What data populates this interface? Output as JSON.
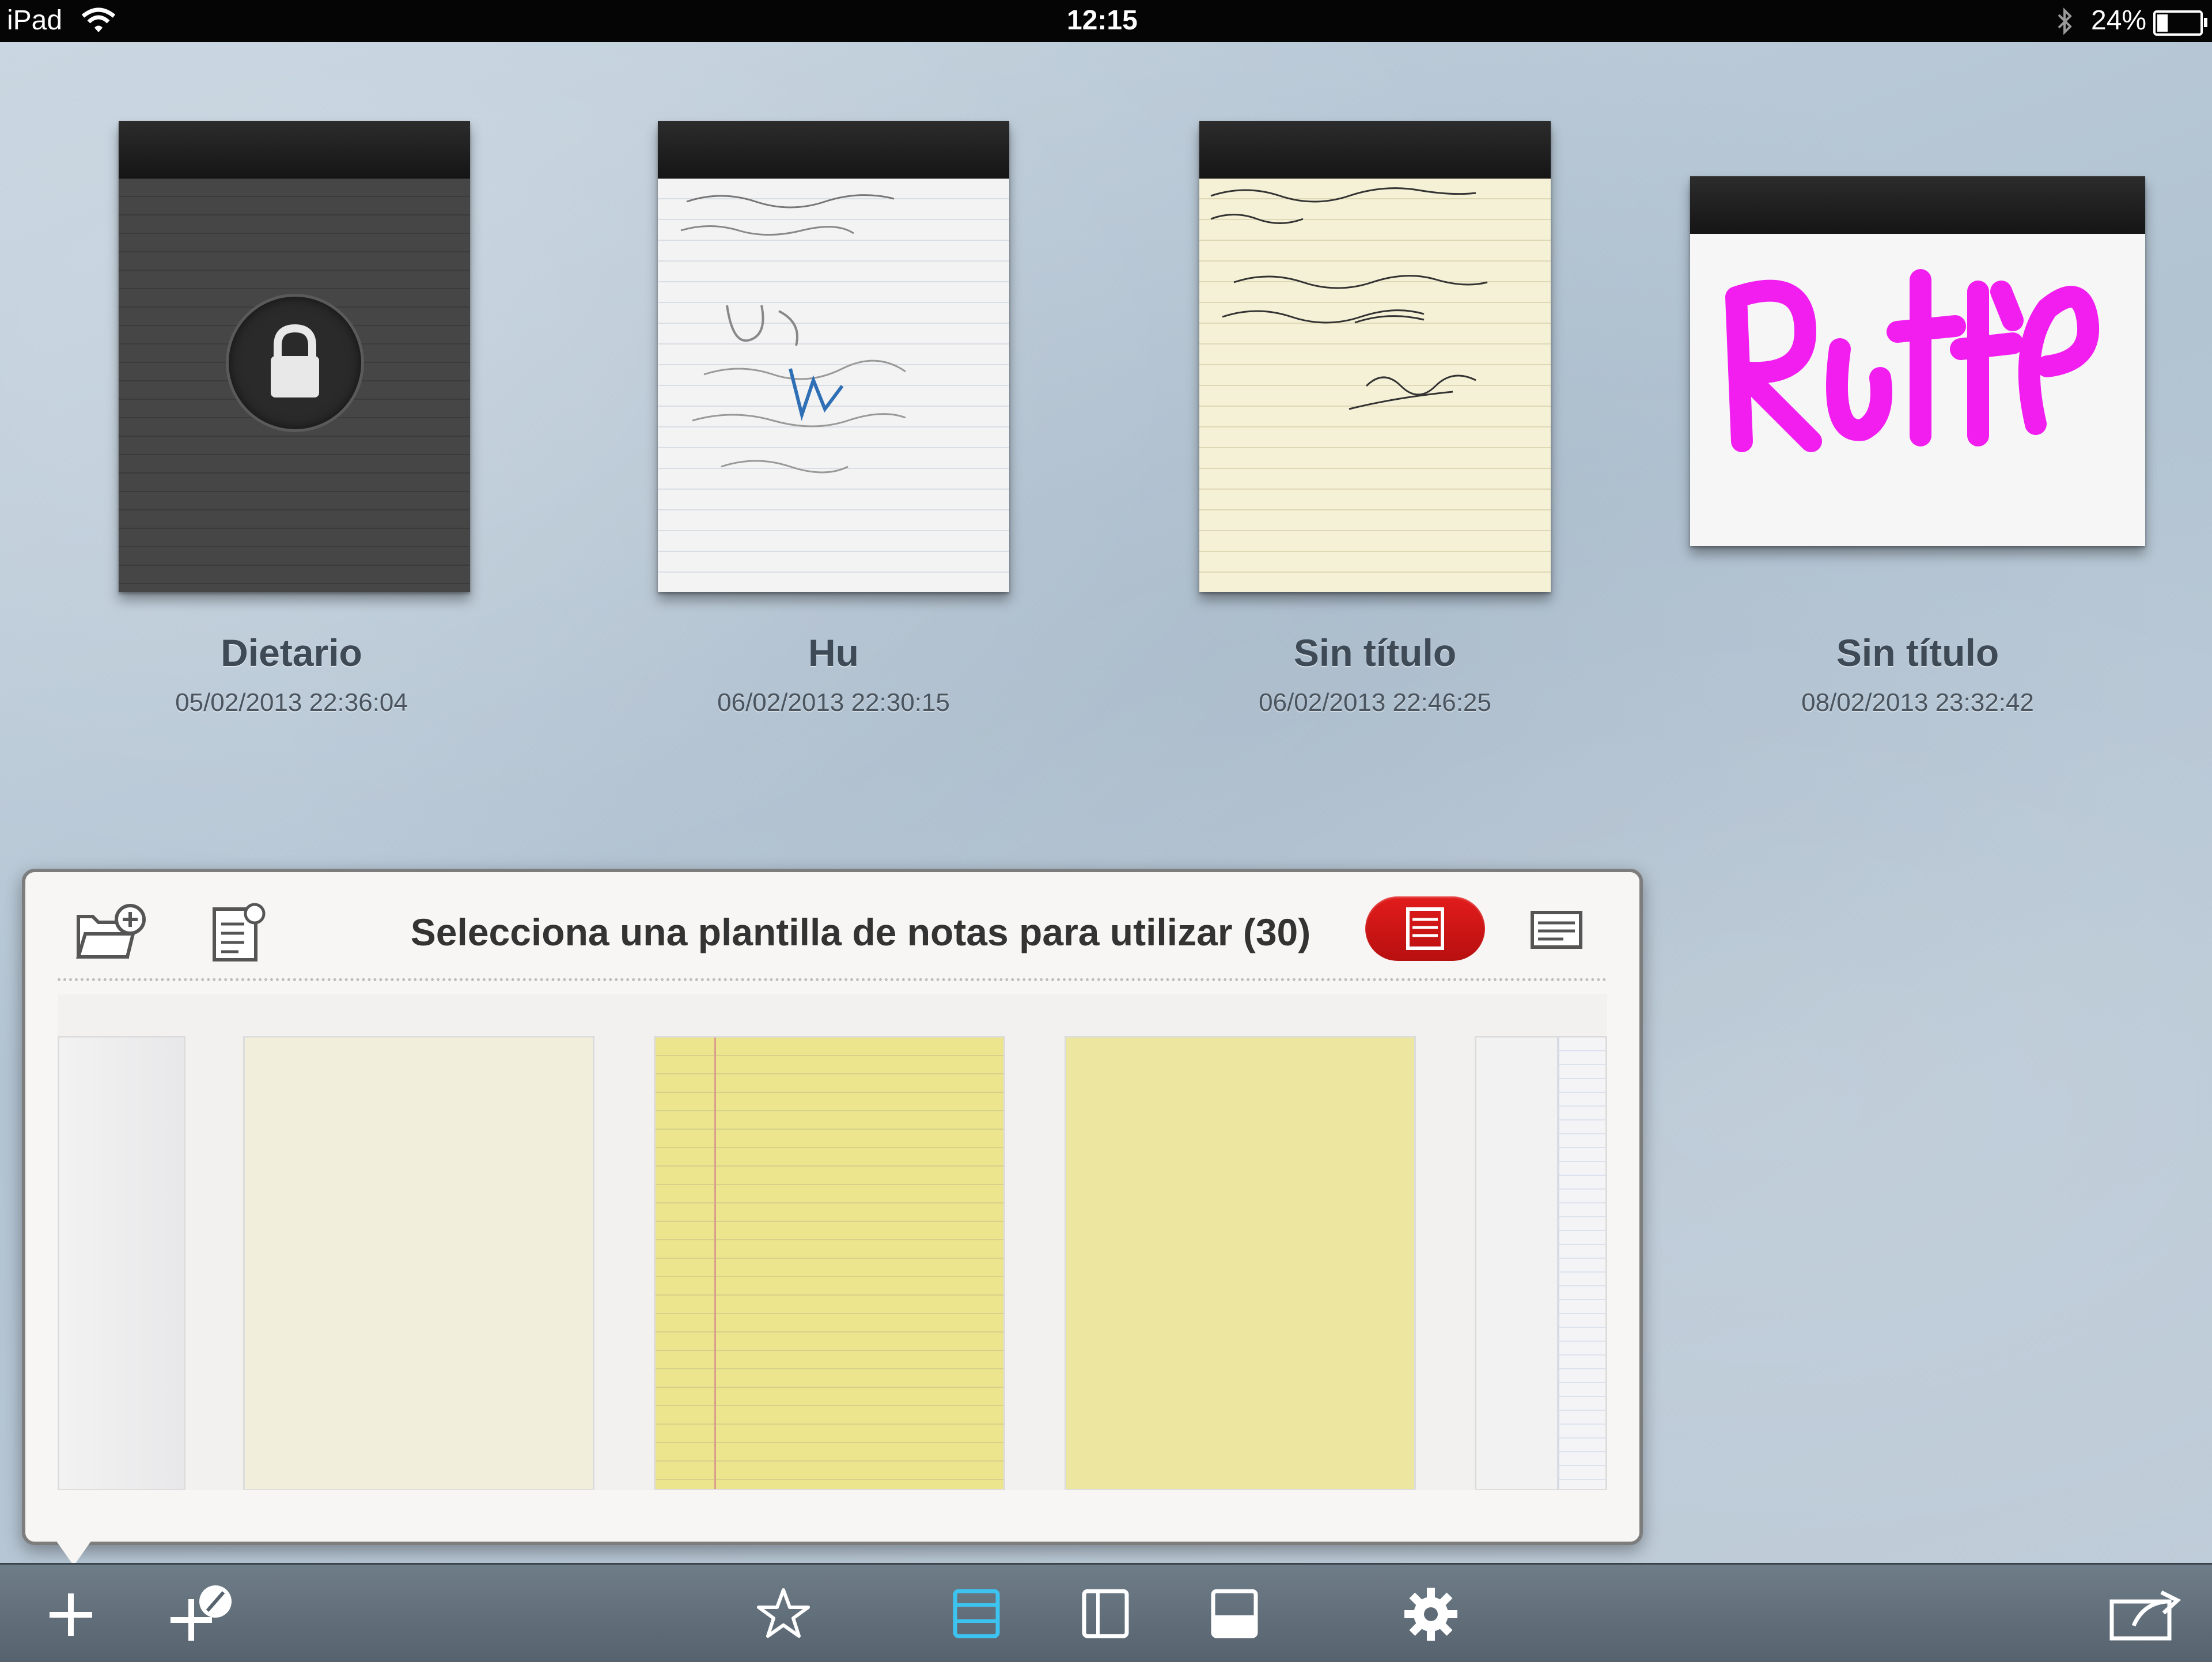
{
  "status_bar": {
    "device": "iPad",
    "time": "12:15",
    "battery": "24%",
    "icons": [
      "wifi-icon",
      "bluetooth-icon",
      "battery-icon"
    ]
  },
  "notebooks": [
    {
      "title": "Dietario",
      "date": "05/02/2013 22:36:04",
      "locked": true
    },
    {
      "title": "Hu",
      "date": "06/02/2013 22:30:15",
      "locked": false
    },
    {
      "title": "Sin título",
      "date": "06/02/2013 22:46:25",
      "locked": false
    },
    {
      "title": "Sin título",
      "date": "08/02/2013 23:32:42",
      "locked": false
    }
  ],
  "popover": {
    "title": "Selecciona una plantilla de notas para utilizar (30)",
    "icons": [
      "add-folder-icon",
      "note-settings-icon",
      "portrait-template-icon",
      "landscape-template-icon"
    ],
    "selected_view": "portrait-template"
  },
  "toolbar": {
    "icons": [
      "add-icon",
      "add-tools-icon",
      "star-icon",
      "grid-view-icon",
      "split-view-icon",
      "half-view-icon",
      "gear-icon",
      "share-icon"
    ],
    "active": "grid-view-icon",
    "accent": "#3cc3f0"
  },
  "colors": {
    "popover_toggle_active": "#cc1414",
    "ink_magenta": "#f21ef0"
  }
}
